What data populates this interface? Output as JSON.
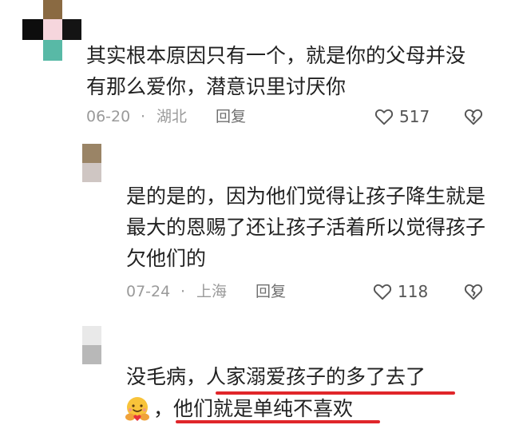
{
  "comments": [
    {
      "text": "其实根本原因只有一个，就是你的父母并没有那么爱你，潜意识里讨厌你",
      "date": "06-20",
      "location": "湖北",
      "reply_label": "回复",
      "likes": "517"
    },
    {
      "text": "是的是的，因为他们觉得让孩子降生就是最大的恩赐了还让孩子活着所以觉得孩子欠他们的",
      "date": "07-24",
      "location": "上海",
      "reply_label": "回复",
      "likes": "118"
    },
    {
      "text_line1": "没毛病，人家溺爱孩子的多了去了",
      "text_line2": "，他们就是单纯不喜欢"
    }
  ],
  "separator": "·",
  "icons": {
    "like": "heart-outline-icon",
    "dislike": "broken-heart-icon",
    "emoji": "hugging-face-emoji"
  },
  "colors": {
    "underline": "#e0262a",
    "meta_text": "#9a9a9a",
    "body_text": "#222222"
  }
}
